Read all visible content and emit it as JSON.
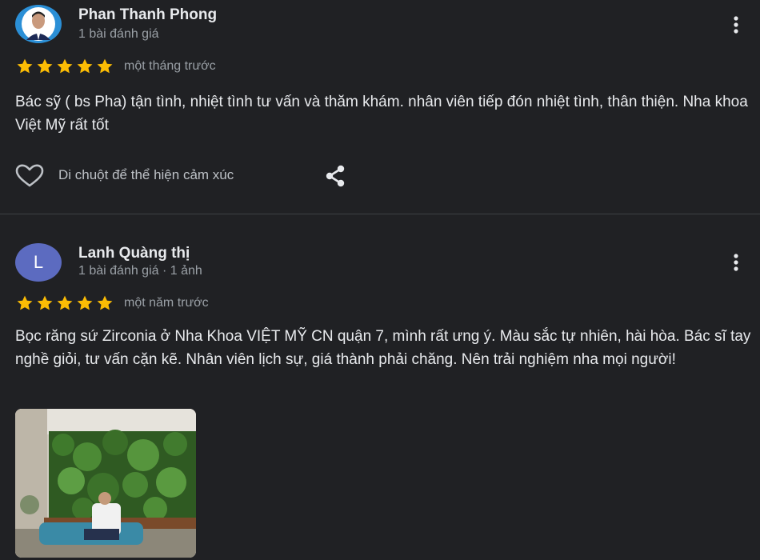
{
  "reviews": [
    {
      "author": "Phan Thanh Phong",
      "meta": "1 bài đánh giá",
      "rating": 5,
      "time": "một tháng trước",
      "text": "Bác sỹ ( bs Pha) tận tình, nhiệt tình tư vấn và thăm khám. nhân viên tiếp đón nhiệt tình, thân thiện. Nha khoa Việt Mỹ rất tốt",
      "react_label": "Di chuột để thể hiện cảm xúc"
    },
    {
      "author": "Lanh Quàng thị",
      "avatar_letter": "L",
      "meta": "1 bài đánh giá · 1 ảnh",
      "rating": 5,
      "time": "một năm trước",
      "text": "Bọc răng sứ Zirconia ở Nha Khoa VIỆT MỸ CN quận 7, mình rất ưng ý. Màu sắc tự nhiên, hài hòa. Bác sĩ tay nghề giỏi, tư vấn cặn kẽ. Nhân viên lịch sự, giá thành phải chăng. Nên trải nghiệm nha mọi người!"
    }
  ],
  "colors": {
    "background": "#202124",
    "star": "#fbbc04",
    "text_primary": "#e8eaed",
    "text_secondary": "#9aa0a6",
    "avatar_letter_bg": "#5c6bc0"
  },
  "icons": [
    "user-avatar-photo",
    "more-vert-icon",
    "star-icon",
    "heart-outline-icon",
    "share-icon"
  ]
}
